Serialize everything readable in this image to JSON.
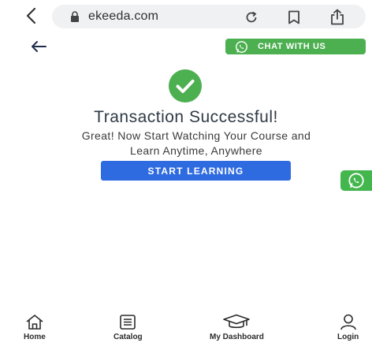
{
  "browser": {
    "url": "ekeeda.com",
    "icons": [
      "back-chevron-icon",
      "lock-icon",
      "reload-icon",
      "bookmark-icon",
      "share-icon"
    ]
  },
  "header": {
    "back_icon": "arrow-left-icon",
    "chat_label": "CHAT WITH US",
    "chat_color": "#4caf50"
  },
  "main": {
    "status_icon": "check-circle-icon",
    "status_color": "#4caf50",
    "title": "Transaction Successful!",
    "subtitle_line1": "Great! Now Start Watching Your Course and",
    "subtitle_line2": "Learn Anytime, Anywhere",
    "cta_label": "START LEARNING",
    "cta_color": "#2f6be0"
  },
  "floating": {
    "whatsapp_icon": "whatsapp-icon"
  },
  "bottom_nav": {
    "items": [
      {
        "label": "Home",
        "icon": "home-icon"
      },
      {
        "label": "Catalog",
        "icon": "catalog-icon"
      },
      {
        "label": "My Dashboard",
        "icon": "graduation-cap-icon"
      },
      {
        "label": "Login",
        "icon": "user-icon"
      }
    ]
  }
}
